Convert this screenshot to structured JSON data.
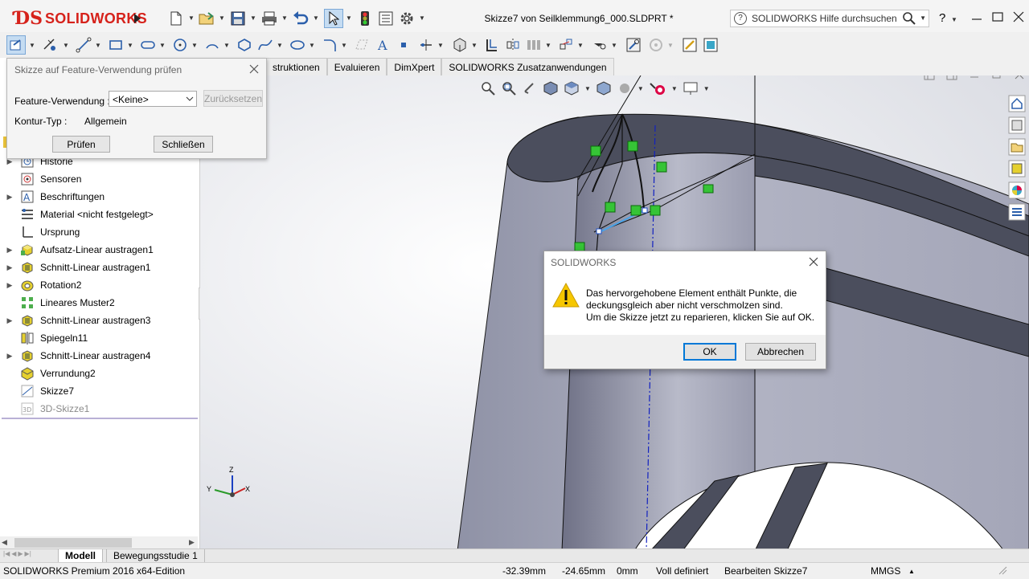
{
  "app": {
    "brand": "SOLIDWORKS",
    "doc_title": "Skizze7 von Seilklemmung6_000.SLDPRT *",
    "help_search_placeholder": "SOLIDWORKS Hilfe durchsuchen",
    "help_label": "?",
    "accent_color": "#d6221b"
  },
  "tabs": [
    {
      "label": "struktionen"
    },
    {
      "label": "Evaluieren"
    },
    {
      "label": "DimXpert"
    },
    {
      "label": "SOLIDWORKS Zusatzanwendungen"
    }
  ],
  "check_dialog": {
    "title": "Skizze auf Feature-Verwendung prüfen",
    "feature_label": "Feature-Verwendung :",
    "feature_value": "<Keine>",
    "reset_button": "Zurücksetzen",
    "contour_label": "Kontur-Typ :",
    "contour_value": "Allgemein",
    "check_button": "Prüfen",
    "close_button": "Schließen"
  },
  "tree": [
    {
      "label": "Historie",
      "icon": "history-icon"
    },
    {
      "label": "Sensoren",
      "icon": "sensor-icon"
    },
    {
      "label": "Beschriftungen",
      "icon": "annotation-icon"
    },
    {
      "label": "Material <nicht festgelegt>",
      "icon": "material-icon"
    },
    {
      "label": "Ursprung",
      "icon": "origin-icon"
    },
    {
      "label": "Aufsatz-Linear austragen1",
      "icon": "boss-extrude-icon"
    },
    {
      "label": "Schnitt-Linear austragen1",
      "icon": "cut-extrude-icon"
    },
    {
      "label": "Rotation2",
      "icon": "revolve-icon"
    },
    {
      "label": "Lineares Muster2",
      "icon": "linear-pattern-icon"
    },
    {
      "label": "Schnitt-Linear austragen3",
      "icon": "cut-extrude-icon"
    },
    {
      "label": "Spiegeln11",
      "icon": "mirror-icon"
    },
    {
      "label": "Schnitt-Linear austragen4",
      "icon": "cut-extrude-icon"
    },
    {
      "label": "Verrundung2",
      "icon": "fillet-icon"
    },
    {
      "label": "Skizze7",
      "icon": "sketch-icon"
    },
    {
      "label": "3D-Skizze1",
      "icon": "3d-sketch-icon"
    }
  ],
  "message_box": {
    "title": "SOLIDWORKS",
    "line1": "Das hervorgehobene Element enthält Punkte, die",
    "line2": "deckungsgleich aber nicht verschmolzen sind.",
    "line3": "Um die Skizze jetzt zu reparieren, klicken Sie auf OK.",
    "ok_button": "OK",
    "cancel_button": "Abbrechen"
  },
  "triad": {
    "x": "X",
    "y": "Y",
    "z": "Z"
  },
  "bottom_tabs": [
    {
      "label": "Modell",
      "active": true
    },
    {
      "label": "Bewegungsstudie 1",
      "active": false
    }
  ],
  "status": {
    "edition": "SOLIDWORKS Premium 2016 x64-Edition",
    "x": "-32.39mm",
    "y": "-24.65mm",
    "z": "0mm",
    "state": "Voll definiert",
    "mode": "Bearbeiten Skizze7",
    "units": "MMGS"
  }
}
